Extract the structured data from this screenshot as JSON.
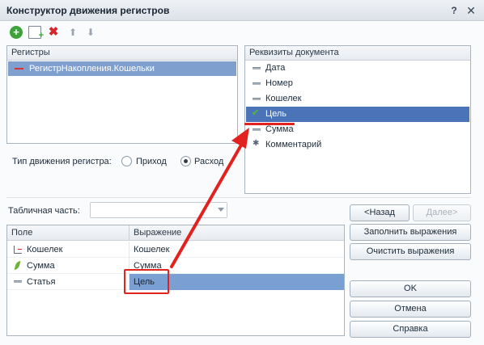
{
  "window": {
    "title": "Конструктор движения регистров",
    "help_label": "?",
    "close_label": "✕"
  },
  "toolbar": {
    "add_icon": "+",
    "delete_icon": "✖",
    "up_icon": "⬆",
    "down_icon": "⬇"
  },
  "registers": {
    "header": "Регистры",
    "items": [
      {
        "label": "РегистрНакопления.Кошельки",
        "selected": true
      }
    ]
  },
  "properties": {
    "header": "Реквизиты документа",
    "items": [
      {
        "label": "Дата",
        "icon": "attribute-icon"
      },
      {
        "label": "Номер",
        "icon": "attribute-icon"
      },
      {
        "label": "Кошелек",
        "icon": "attribute-icon"
      },
      {
        "label": "Цель",
        "icon": "check-icon",
        "selected": true
      },
      {
        "label": "Сумма",
        "icon": "attribute-icon"
      },
      {
        "label": "Комментарий",
        "icon": "star-icon"
      }
    ]
  },
  "movement": {
    "label": "Тип движения регистра:",
    "income_label": "Приход",
    "expense_label": "Расход",
    "selected": "expense"
  },
  "tabular": {
    "label": "Табличная часть:",
    "value": ""
  },
  "mapping": {
    "col_field": "Поле",
    "col_expression": "Выражение",
    "rows": [
      {
        "field": "Кошелек",
        "icon": "dimension-icon",
        "expression": "Кошелек"
      },
      {
        "field": "Сумма",
        "icon": "resource-icon",
        "expression": "Сумма"
      },
      {
        "field": "Статья",
        "icon": "attribute-icon",
        "expression": "Цель",
        "selected": true
      }
    ]
  },
  "buttons": {
    "back": "<Назад",
    "next": "Далее>",
    "fill": "Заполнить выражения",
    "clear": "Очистить выражения",
    "ok": "OK",
    "cancel": "Отмена",
    "help": "Справка"
  },
  "colors": {
    "selection": "#4a73b8",
    "annotation": "#e2221f"
  }
}
